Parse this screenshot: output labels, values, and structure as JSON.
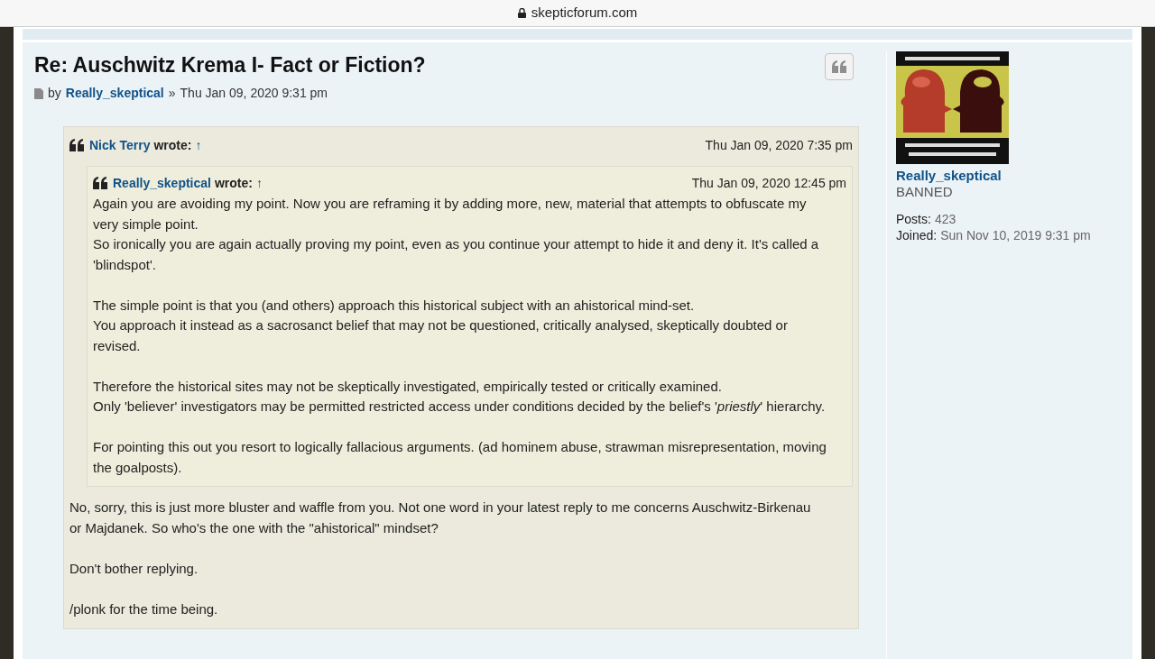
{
  "browser": {
    "url": "skepticforum.com"
  },
  "post": {
    "title": "Re: Auschwitz Krema I- Fact or Fiction?",
    "by": "by",
    "author": "Really_skeptical",
    "separator": "»",
    "date": "Thu Jan 09, 2020 9:31 pm",
    "quote": {
      "author": "Nick Terry",
      "wrote": "wrote:",
      "arrow": "↑",
      "date": "Thu Jan 09, 2020 7:35 pm",
      "nested": {
        "author": "Really_skeptical",
        "wrote": "wrote:",
        "arrow": "↑",
        "date": "Thu Jan 09, 2020 12:45 pm",
        "paragraphs": [
          [
            "Again you are avoiding my point. Now you are reframing it by adding more, new, material that attempts to obfuscate my very simple point.",
            "So ironically you are again actually proving my point, even as you continue your attempt to hide it and deny it. It's called a 'blindspot'."
          ],
          [
            "The simple point is that you (and others) approach this historical subject with an ahistorical mind-set.",
            "You approach it instead as a sacrosanct belief that may not be questioned, critically analysed, skeptically doubted or revised."
          ],
          [
            "Therefore the historical sites may not be skeptically investigated, empirically tested or critically examined.",
            "Only 'believer' investigators may be permitted restricted access under conditions decided by the belief's '*priestly*' hierarchy."
          ],
          [
            "For pointing this out you resort to logically fallacious arguments. (ad hominem abuse, strawman misrepresentation, moving the goalposts)."
          ]
        ]
      }
    },
    "reply": [
      "No, sorry, this is just more bluster and waffle from you. Not one word in your latest reply to me concerns Auschwitz-Birkenau or Majdanek. So who's the one with the \"ahistorical\" mindset?",
      "Don't bother replying.",
      "/plonk for the time being."
    ]
  },
  "profile": {
    "username": "Really_skeptical",
    "rank": "BANNED",
    "stats": [
      {
        "label": "Posts:",
        "value": "423"
      },
      {
        "label": "Joined:",
        "value": "Sun Nov 10, 2019 9:31 pm"
      }
    ]
  }
}
